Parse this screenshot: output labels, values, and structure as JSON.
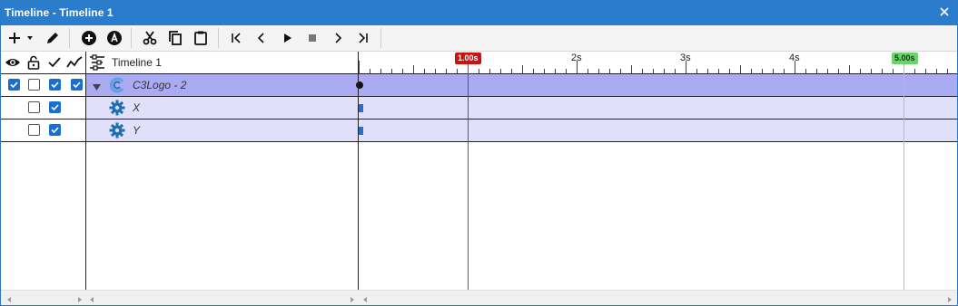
{
  "window": {
    "title": "Timeline - Timeline 1"
  },
  "toolbar": {
    "buttons": [
      {
        "name": "add-icon"
      },
      {
        "name": "dropdown-arrow-icon"
      },
      {
        "name": "pencil-icon"
      },
      {
        "name": "add-circle-icon"
      },
      {
        "name": "auto-circle-icon"
      },
      {
        "name": "scissors-icon"
      },
      {
        "name": "copy-icon"
      },
      {
        "name": "paste-icon"
      },
      {
        "name": "go-to-start-icon"
      },
      {
        "name": "step-back-icon"
      },
      {
        "name": "play-icon"
      },
      {
        "name": "stop-icon"
      },
      {
        "name": "step-forward-icon"
      },
      {
        "name": "go-to-end-icon"
      }
    ]
  },
  "header": {
    "icons": [
      "eye-icon",
      "lock-icon",
      "checkmark-icon",
      "curve-icon",
      "timeline-icon"
    ],
    "timeline_name": "Timeline 1"
  },
  "ruler": {
    "tick_labels": [
      "2s",
      "3s",
      "4s"
    ],
    "playhead_label": "1.00s",
    "end_label": "5.00s"
  },
  "tracks": [
    {
      "name": "C3Logo - 2",
      "type": "instance",
      "icon": "construct-logo-icon",
      "visible": true,
      "locked": false,
      "enabled": true,
      "curve": true
    },
    {
      "name": "X",
      "type": "property",
      "icon": "gear-icon",
      "locked": false,
      "enabled": true
    },
    {
      "name": "Y",
      "type": "property",
      "icon": "gear-icon",
      "locked": false,
      "enabled": true
    }
  ],
  "colors": {
    "titlebar": "#2b7ccd",
    "instance_row": "#ababf3",
    "property_row": "#e0e0fb",
    "playhead": "#cc1111",
    "end_marker": "#6ad36a",
    "checkbox_on": "#1b6ecf",
    "keyframe": "#2d6ccf"
  }
}
